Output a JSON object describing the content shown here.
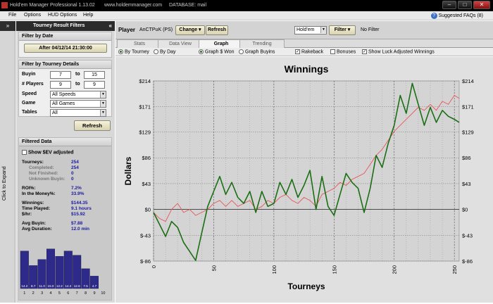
{
  "window": {
    "title": "Hold'em Manager Professional 1.13.02",
    "site": "www.holdemmanager.com",
    "database": "DATABASE: mail"
  },
  "menu": {
    "items": [
      "File",
      "Options",
      "HUD Options",
      "Help"
    ],
    "faq": "Suggested FAQs (8)"
  },
  "expand": {
    "arrow": "»",
    "label": "Click to Expand"
  },
  "sidebar": {
    "title": "Tourney Result Filters",
    "collapse": "«",
    "date": {
      "header": "Filter by Date",
      "button": "After 04/12/14 21:30:00"
    },
    "details": {
      "header": "Filter by Tourney Details",
      "buyin": {
        "label": "Buyin",
        "from": "7",
        "to_label": "to",
        "to": "15"
      },
      "players": {
        "label": "# Players",
        "from": "9",
        "to_label": "to",
        "to": "9"
      },
      "speed": {
        "label": "Speed",
        "value": "All Speeds"
      },
      "game": {
        "label": "Game",
        "value": "All Games"
      },
      "tables": {
        "label": "Tables",
        "value": "All"
      }
    },
    "refresh": "Refresh",
    "filtered": {
      "header": "Filtered Data",
      "show_ev": "Show $EV adjusted",
      "stats": [
        {
          "k": "Tourneys:",
          "v": "254",
          "sub": false
        },
        {
          "k": "Completed:",
          "v": "254",
          "sub": true
        },
        {
          "k": "Not Finished:",
          "v": "0",
          "sub": true
        },
        {
          "k": "Unknown Buyin:",
          "v": "0",
          "sub": true
        },
        {
          "k": "ROI%:",
          "v": "7.2%",
          "sub": false,
          "gap": true
        },
        {
          "k": "In the Money%:",
          "v": "33.9%",
          "sub": false
        },
        {
          "k": "Winnings:",
          "v": "$144.35",
          "sub": false,
          "gap": true
        },
        {
          "k": "Time Played:",
          "v": "9.1 hours",
          "sub": false
        },
        {
          "k": "$/hr:",
          "v": "$15.92",
          "sub": false
        },
        {
          "k": "Avg Buyin:",
          "v": "$7.88",
          "sub": false,
          "gap": true
        },
        {
          "k": "Avg Duration:",
          "v": "12.0 min",
          "sub": false
        }
      ]
    },
    "finish_chart": {
      "labels": [
        "1",
        "2",
        "3",
        "4",
        "5",
        "6",
        "7",
        "8",
        "9",
        "10"
      ],
      "values": [
        14.2,
        8.7,
        11.0,
        15.0,
        12.2,
        14.2,
        12.6,
        7.5,
        4.7,
        0
      ]
    }
  },
  "toolbar": {
    "player_label": "Player",
    "player": "AnCTPuK (PS)",
    "change": "Change",
    "refresh": "Refresh",
    "game": "Hold'em",
    "filter": "Filter",
    "filter_status": "No Filter"
  },
  "tabs": [
    "Stats",
    "Data View",
    "Graph",
    "Trending"
  ],
  "options": {
    "by_tourney": "By Tourney",
    "by_day": "By Day",
    "graph_won": "Graph $ Won",
    "graph_buyins": "Graph Buyins",
    "rakeback": "Rakeback",
    "bonuses": "Bonuses",
    "luck": "Show Luck Adjusted Winnings"
  },
  "colors": {
    "won": "#1b6e14",
    "luck": "#e8555a",
    "accent": "#2d2a8a"
  },
  "chart_data": {
    "type": "line",
    "title": "Winnings",
    "xlabel": "Tourneys",
    "ylabel": "Dollars",
    "xlim": [
      0,
      254
    ],
    "ylim": [
      -86,
      214
    ],
    "x_ticks": [
      0,
      50,
      100,
      150,
      200,
      250
    ],
    "y_ticks": [
      "$-86",
      "$-43",
      "$0",
      "$43",
      "$86",
      "$129",
      "$171",
      "$214"
    ],
    "y_tick_values": [
      -86,
      -43,
      0,
      43,
      86,
      129,
      171,
      214
    ],
    "grid": true,
    "series": [
      {
        "key": "won",
        "x": [
          0,
          5,
          10,
          15,
          20,
          25,
          30,
          35,
          40,
          45,
          50,
          55,
          60,
          65,
          70,
          75,
          80,
          85,
          90,
          95,
          100,
          105,
          110,
          115,
          120,
          125,
          130,
          135,
          140,
          145,
          150,
          155,
          160,
          165,
          170,
          175,
          180,
          185,
          190,
          195,
          200,
          205,
          210,
          215,
          220,
          225,
          230,
          235,
          240,
          245,
          250,
          254
        ],
        "y": [
          -5,
          -25,
          -45,
          -20,
          -30,
          -55,
          -70,
          -85,
          -40,
          5,
          30,
          55,
          25,
          45,
          20,
          10,
          30,
          -5,
          30,
          5,
          10,
          45,
          25,
          50,
          20,
          40,
          65,
          0,
          55,
          5,
          -10,
          25,
          60,
          45,
          35,
          -5,
          35,
          90,
          70,
          110,
          140,
          190,
          160,
          210,
          175,
          140,
          170,
          145,
          165,
          155,
          150,
          145
        ]
      },
      {
        "key": "luck",
        "x": [
          0,
          5,
          10,
          15,
          20,
          25,
          30,
          35,
          40,
          45,
          50,
          55,
          60,
          65,
          70,
          75,
          80,
          85,
          90,
          95,
          100,
          105,
          110,
          115,
          120,
          125,
          130,
          135,
          140,
          145,
          150,
          155,
          160,
          165,
          170,
          175,
          180,
          185,
          190,
          195,
          200,
          205,
          210,
          215,
          220,
          225,
          230,
          235,
          240,
          245,
          250,
          254
        ],
        "y": [
          -5,
          -15,
          -20,
          0,
          10,
          -5,
          0,
          -10,
          -5,
          0,
          10,
          15,
          5,
          15,
          5,
          10,
          15,
          0,
          5,
          15,
          10,
          20,
          25,
          15,
          10,
          20,
          15,
          5,
          25,
          30,
          35,
          45,
          40,
          50,
          55,
          60,
          75,
          90,
          100,
          115,
          130,
          140,
          150,
          160,
          170,
          165,
          175,
          165,
          180,
          175,
          190,
          185
        ]
      }
    ]
  }
}
